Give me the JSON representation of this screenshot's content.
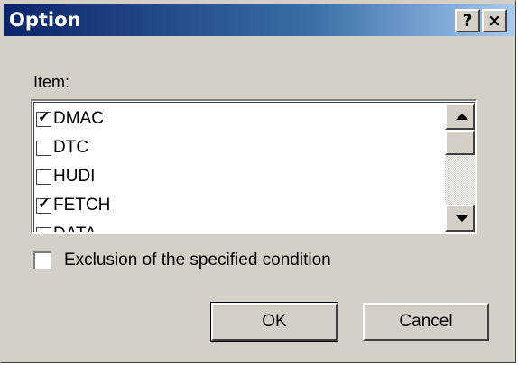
{
  "window": {
    "title": "Option",
    "help_label": "?",
    "close_label": "×"
  },
  "item_label": "Item:",
  "items": [
    {
      "label": "DMAC",
      "checked": true
    },
    {
      "label": "DTC",
      "checked": false
    },
    {
      "label": "HUDI",
      "checked": false
    },
    {
      "label": "FETCH",
      "checked": true
    },
    {
      "label": "DATA",
      "checked": false
    }
  ],
  "exclusion": {
    "label": "Exclusion of the specified condition",
    "checked": false
  },
  "buttons": {
    "ok": "OK",
    "cancel": "Cancel"
  }
}
